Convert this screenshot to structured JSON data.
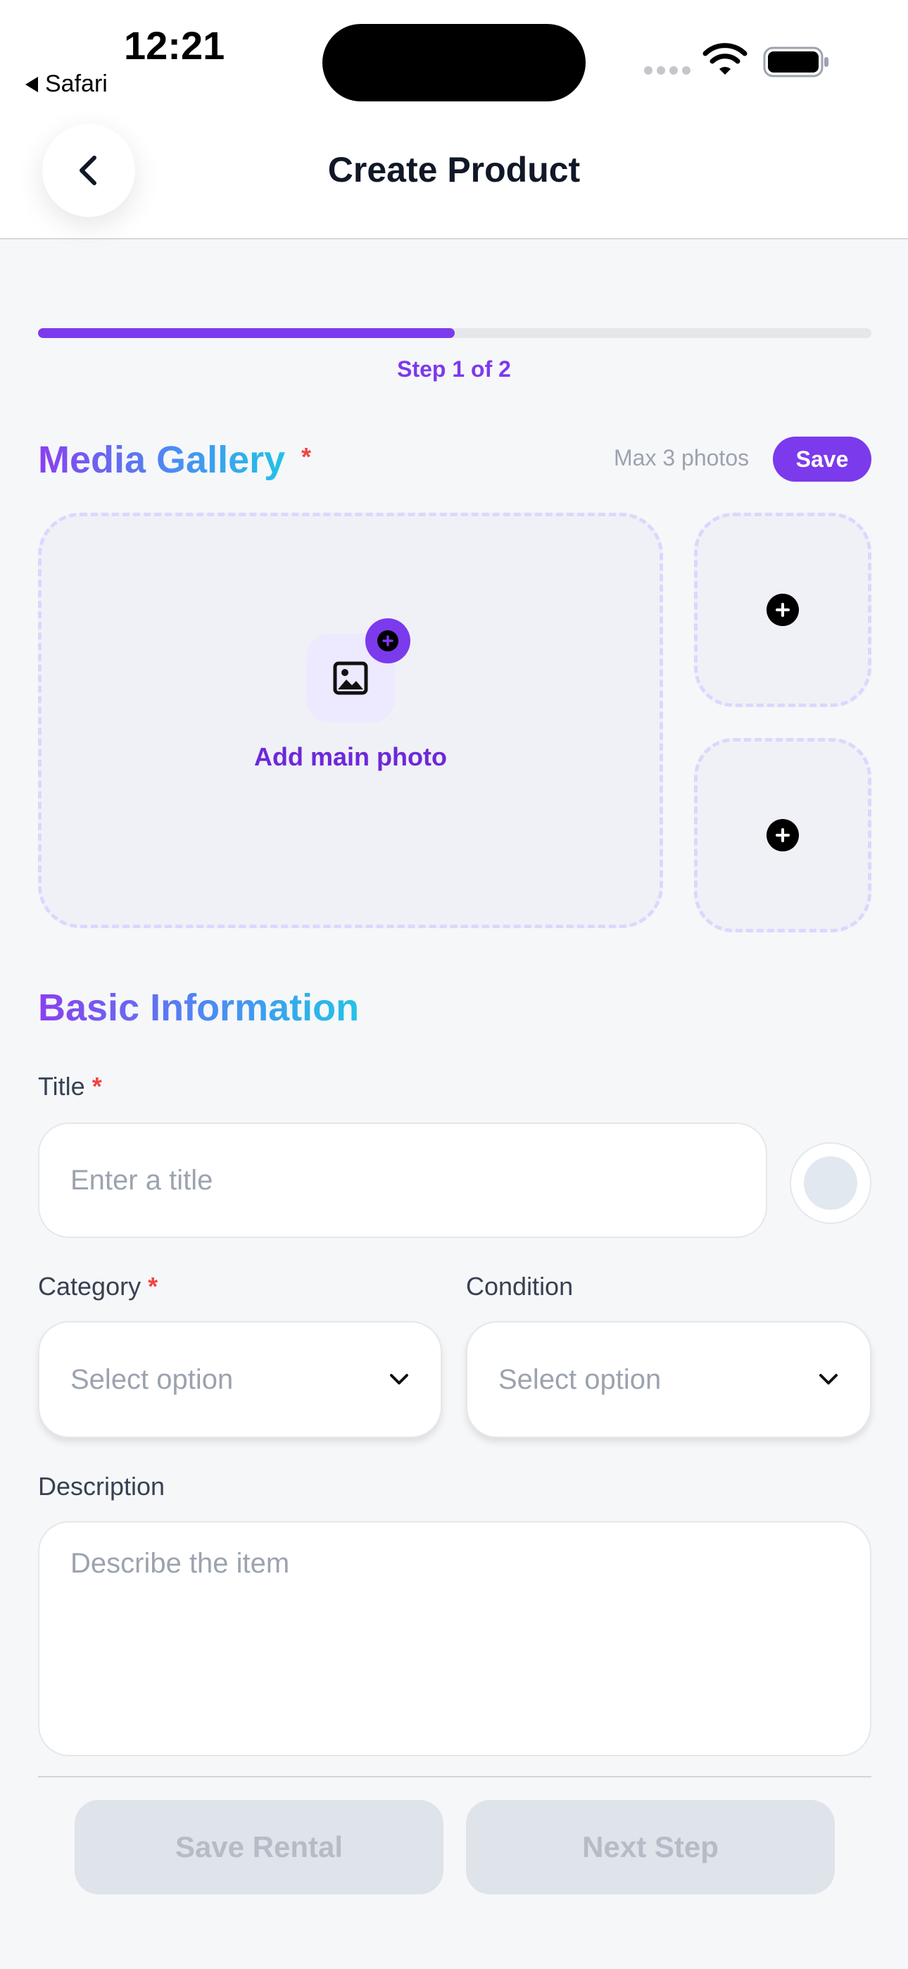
{
  "status_bar": {
    "time": "12:21",
    "back_app": "Safari"
  },
  "header": {
    "title": "Create Product"
  },
  "progress": {
    "fraction": 0.5,
    "label": "Step 1 of 2"
  },
  "media": {
    "title": "Media Gallery",
    "required_mark": "*",
    "max_label": "Max 3 photos",
    "save_label": "Save",
    "add_main_label": "Add main photo"
  },
  "basic": {
    "title": "Basic Information",
    "title_label": "Title",
    "title_required": "*",
    "title_placeholder": "Enter a title",
    "category_label": "Category",
    "category_required": "*",
    "category_value": "Select option",
    "condition_label": "Condition",
    "condition_value": "Select option",
    "description_label": "Description",
    "description_placeholder": "Describe the item"
  },
  "footer": {
    "save_rental": "Save Rental",
    "next_step": "Next Step"
  },
  "colors": {
    "accent": "#7c3aed",
    "required": "#ef4444",
    "disabled": "#dfe3ea"
  }
}
